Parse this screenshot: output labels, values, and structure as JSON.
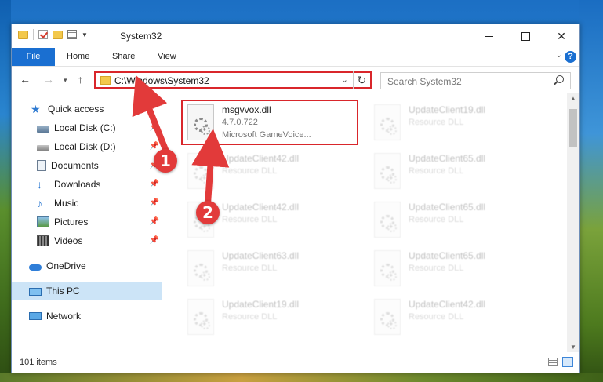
{
  "window": {
    "title": "System32",
    "ribbon_tabs": [
      "File",
      "Home",
      "Share",
      "View"
    ]
  },
  "navigation": {
    "address": "C:\\Windows\\System32",
    "search_placeholder": "Search System32"
  },
  "sidebar": {
    "items": [
      {
        "label": "Quick access",
        "icon": "star-icon",
        "pinned": false
      },
      {
        "label": "Local Disk (C:)",
        "icon": "drive-icon",
        "pinned": true
      },
      {
        "label": "Local Disk (D:)",
        "icon": "drive-icon",
        "pinned": true
      },
      {
        "label": "Documents",
        "icon": "documents-icon",
        "pinned": true
      },
      {
        "label": "Downloads",
        "icon": "download-icon",
        "pinned": true
      },
      {
        "label": "Music",
        "icon": "music-icon",
        "pinned": true
      },
      {
        "label": "Pictures",
        "icon": "pictures-icon",
        "pinned": true
      },
      {
        "label": "Videos",
        "icon": "videos-icon",
        "pinned": true
      },
      {
        "label": "OneDrive",
        "icon": "onedrive-icon",
        "pinned": false
      },
      {
        "label": "This PC",
        "icon": "this-pc-icon",
        "pinned": false,
        "selected": true
      },
      {
        "label": "Network",
        "icon": "network-icon",
        "pinned": false
      }
    ]
  },
  "files": {
    "highlighted": {
      "name": "msgvvox.dll",
      "version": "4.7.0.722",
      "description": "Microsoft GameVoice..."
    },
    "left_column": [
      {
        "name": "UpdateClient42.dll",
        "type": "Resource DLL"
      },
      {
        "name": "UpdateClient42.dll",
        "type": "Resource DLL"
      },
      {
        "name": "UpdateClient63.dll",
        "type": "Resource DLL"
      },
      {
        "name": "UpdateClient19.dll",
        "type": "Resource DLL"
      }
    ],
    "right_column": [
      {
        "name": "UpdateClient19.dll",
        "type": "Resource DLL"
      },
      {
        "name": "UpdateClient65.dll",
        "type": "Resource DLL"
      },
      {
        "name": "UpdateClient65.dll",
        "type": "Resource DLL"
      },
      {
        "name": "UpdateClient65.dll",
        "type": "Resource DLL"
      },
      {
        "name": "UpdateClient42.dll",
        "type": "Resource DLL"
      }
    ]
  },
  "status": {
    "item_count": "101 items"
  },
  "annotations": {
    "badge1": "1",
    "badge2": "2",
    "color": "#e23a3a"
  }
}
